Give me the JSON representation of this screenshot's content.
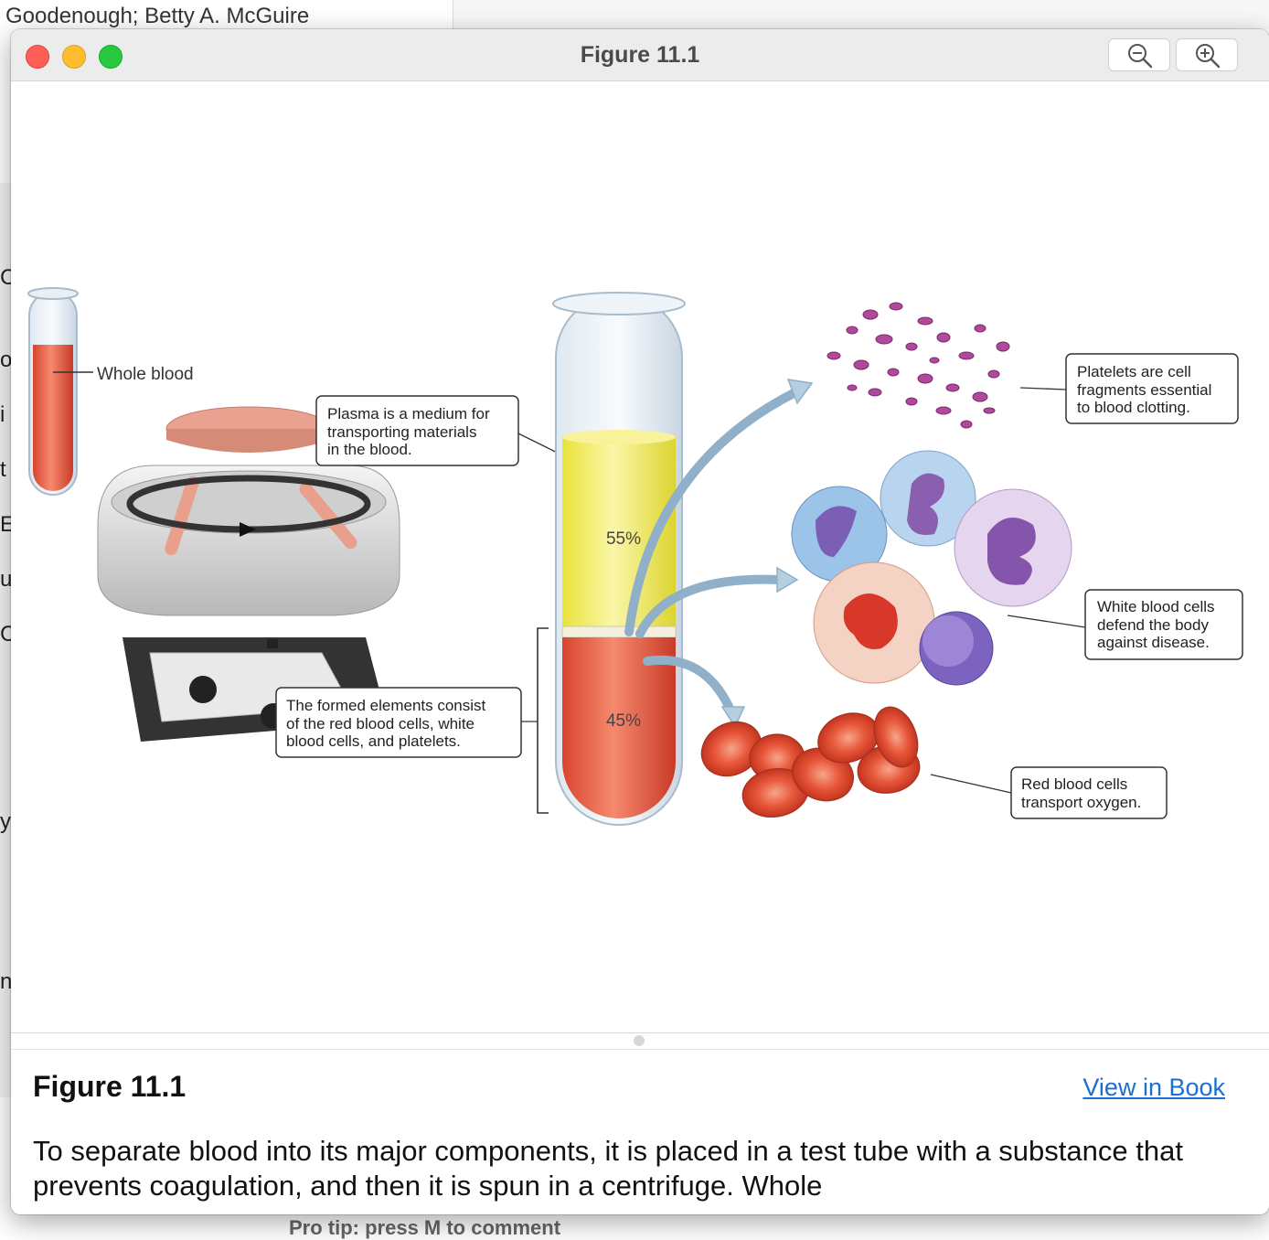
{
  "background": {
    "window_title": "Goodenough; Betty A. McGuire",
    "sidebar_letters": [
      "C",
      "o",
      "i",
      "t",
      "E",
      "u",
      "C",
      "y",
      "n"
    ],
    "bottom_hint": "Pro tip: press M to comment"
  },
  "window": {
    "title": "Figure 11.1",
    "zoom_out_icon": "zoom-out-icon",
    "zoom_in_icon": "zoom-in-icon"
  },
  "figure": {
    "labels": {
      "whole_blood": "Whole blood",
      "plasma": [
        "Plasma is a medium for",
        "transporting materials",
        "in the blood."
      ],
      "formed": [
        "The formed elements consist",
        "of the red blood cells, white",
        "blood cells, and platelets."
      ],
      "platelets": [
        "Platelets are cell",
        "fragments essential",
        "to blood clotting."
      ],
      "wbc": [
        "White blood cells",
        "defend the body",
        "against disease."
      ],
      "rbc": [
        "Red blood cells",
        "transport oxygen."
      ],
      "plasma_pct": "55%",
      "formed_pct": "45%"
    },
    "colors": {
      "plasma": "#f2ec4a",
      "blood": "#e8503a",
      "arrow": "#b6cfe0",
      "platelet": "#b0489c"
    }
  },
  "caption": {
    "title": "Figure 11.1",
    "link": "View in Book",
    "text": "To separate blood into its major components, it is placed in a test tube with a substance that prevents coagulation, and then it is spun in a centrifuge. Whole"
  }
}
